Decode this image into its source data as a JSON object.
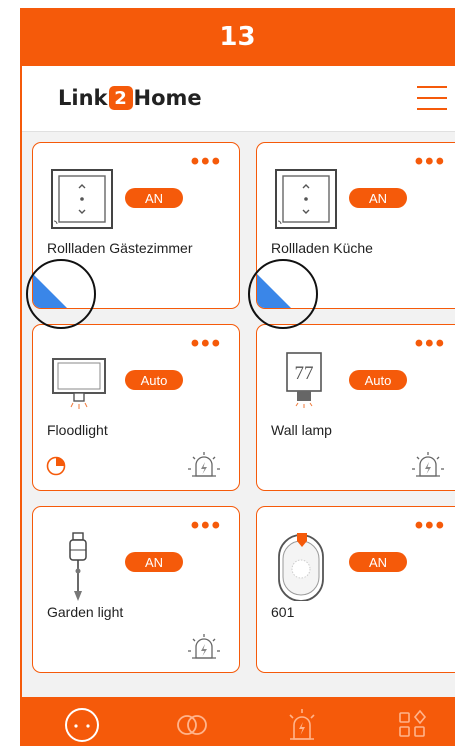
{
  "step": "13",
  "header": {
    "logo_left": "Link",
    "logo_badge": "2",
    "logo_right": "Home"
  },
  "cards": [
    {
      "name": "Rollladen Gästezimmer",
      "status": "AN",
      "icon": "roller-shutter-switch-icon"
    },
    {
      "name": "Rollladen Küche",
      "status": "AN",
      "icon": "roller-shutter-switch-icon"
    },
    {
      "name": "Floodlight",
      "status": "Auto",
      "icon": "floodlight-icon"
    },
    {
      "name": "Wall lamp",
      "status": "Auto",
      "icon": "wall-lamp-icon",
      "icon_number": "77"
    },
    {
      "name": "Garden light",
      "status": "AN",
      "icon": "garden-light-icon"
    },
    {
      "name": "601",
      "status": "AN",
      "icon": "plug-device-icon"
    }
  ],
  "more": "•••",
  "nav": [
    "devices-icon",
    "scenes-icon",
    "alarm-icon",
    "apps-icon"
  ],
  "colors": {
    "accent": "#f55a0a",
    "shutter_blue": "#3a86e8",
    "background": "#f2f2f2"
  }
}
